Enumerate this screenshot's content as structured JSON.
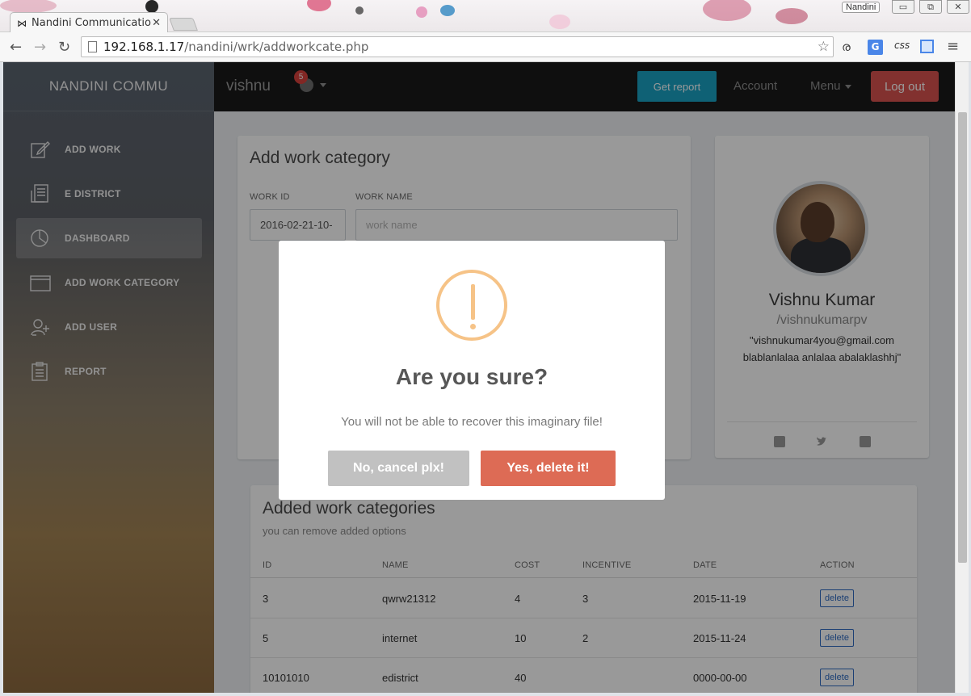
{
  "browser": {
    "tab_title": "Nandini Communication",
    "tab_close": "✕",
    "url_host": "192.168.1.17",
    "url_path": "/nandini/wrk/addworkcate.php",
    "window_user": "Nandini",
    "ext_css": "css",
    "ext_translate": "G",
    "ext_reader": "ര",
    "window_buttons": [
      "▭",
      "⧉",
      "✕"
    ]
  },
  "sidebar": {
    "brand": "NANDINI COMMU",
    "items": [
      {
        "label": "ADD WORK",
        "icon": "edit-icon"
      },
      {
        "label": "E DISTRICT",
        "icon": "document-icon"
      },
      {
        "label": "DASHBOARD",
        "icon": "pie-chart-icon",
        "active": true
      },
      {
        "label": "ADD WORK CATEGORY",
        "icon": "folder-icon"
      },
      {
        "label": "ADD USER",
        "icon": "add-user-icon"
      },
      {
        "label": "REPORT",
        "icon": "clipboard-icon"
      }
    ]
  },
  "topbar": {
    "user": "vishnu",
    "notification_count": "5",
    "get_report": "Get report",
    "account": "Account",
    "menu": "Menu",
    "logout": "Log out"
  },
  "add_work": {
    "title": "Add work category",
    "work_id_label": "WORK ID",
    "work_id_value": "2016-02-21-10-",
    "work_name_label": "WORK NAME",
    "work_name_placeholder": "work name"
  },
  "profile": {
    "name": "Vishnu Kumar",
    "handle": "/vishnukumarpv",
    "bio": "\"vishnukumar4you@gmail.com blablanlalaa anlalaa abalaklashhj\"",
    "social": [
      "facebook-icon",
      "twitter-icon",
      "google-plus-icon"
    ]
  },
  "categories": {
    "title": "Added work categories",
    "subtitle": "you can remove added options",
    "columns": [
      "ID",
      "NAME",
      "COST",
      "INCENTIVE",
      "DATE",
      "ACTION"
    ],
    "rows": [
      {
        "id": "3",
        "name": "qwrw21312",
        "cost": "4",
        "incentive": "3",
        "date": "2015-11-19",
        "action": "delete"
      },
      {
        "id": "5",
        "name": "internet",
        "cost": "10",
        "incentive": "2",
        "date": "2015-11-24",
        "action": "delete"
      },
      {
        "id": "10101010",
        "name": "edistrict",
        "cost": "40",
        "incentive": "",
        "date": "0000-00-00",
        "action": "delete"
      }
    ]
  },
  "dialog": {
    "title": "Are you sure?",
    "text": "You will not be able to recover this imaginary file!",
    "cancel": "No, cancel plx!",
    "confirm": "Yes, delete it!",
    "icon": "warning-icon"
  },
  "colors": {
    "confirm": "#dd6b55",
    "cancel": "#c1c1c1",
    "warning": "#f6c387",
    "get_report": "#1aa2c4",
    "logout": "#d9534f"
  }
}
